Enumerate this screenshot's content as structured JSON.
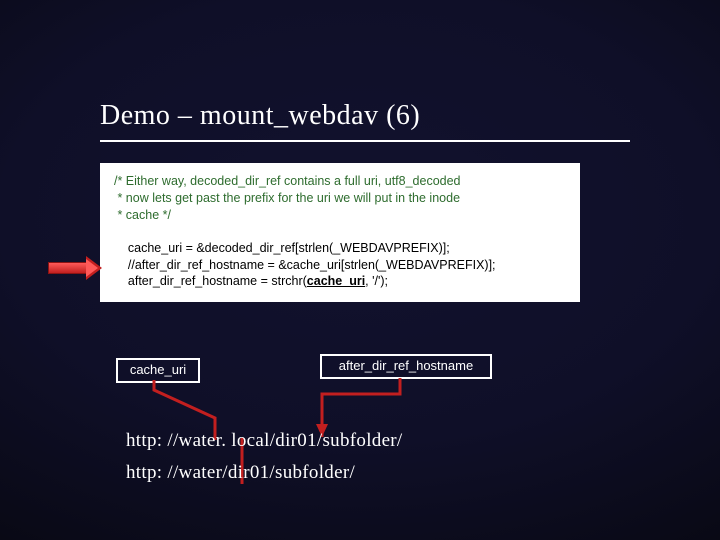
{
  "title": "Demo – mount_webdav (6)",
  "code": {
    "comment1": "/* Either way, decoded_dir_ref contains a full uri, utf8_decoded",
    "comment2": " * now lets get past the prefix for the uri we will put in the inode",
    "comment3": " * cache */",
    "line1": "    cache_uri = &decoded_dir_ref[strlen(_WEBDAVPREFIX)];",
    "line2": "    //after_dir_ref_hostname = &cache_uri[strlen(_WEBDAVPREFIX)];",
    "line3_pre": "    after_dir_ref_hostname = strchr(",
    "line3_bold": "cache_uri",
    "line3_post": ", '/');"
  },
  "labels": {
    "cache_uri": "cache_uri",
    "after_dir_ref_hostname": "after_dir_ref_hostname"
  },
  "urls": {
    "url1": "http: //water. local/dir01/subfolder/",
    "url2": "http: //water/dir01/subfolder/"
  }
}
